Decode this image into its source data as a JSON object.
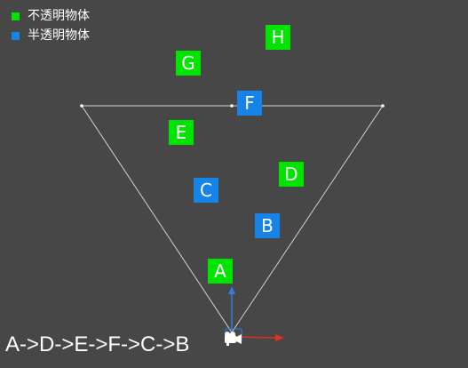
{
  "legend": {
    "opaque": {
      "label": "不透明物体",
      "color": "#00e400"
    },
    "translucent": {
      "label": "半透明物体",
      "color": "#1583e8"
    }
  },
  "objects": [
    {
      "id": "A",
      "label": "A",
      "kind": "opaque"
    },
    {
      "id": "B",
      "label": "B",
      "kind": "translucent"
    },
    {
      "id": "C",
      "label": "C",
      "kind": "translucent"
    },
    {
      "id": "D",
      "label": "D",
      "kind": "opaque"
    },
    {
      "id": "E",
      "label": "E",
      "kind": "opaque"
    },
    {
      "id": "F",
      "label": "F",
      "kind": "translucent"
    },
    {
      "id": "G",
      "label": "G",
      "kind": "opaque"
    },
    {
      "id": "H",
      "label": "H",
      "kind": "opaque"
    }
  ],
  "render_order": "A->D->E->F->C->B",
  "colors": {
    "background": "#474747",
    "frustum_line": "#d0d0d0",
    "gizmo_y_axis": "#3a7ad8",
    "gizmo_x_axis": "#e03020",
    "camera_icon": "#ffffff"
  },
  "icons": {
    "camera": "camera-icon"
  }
}
